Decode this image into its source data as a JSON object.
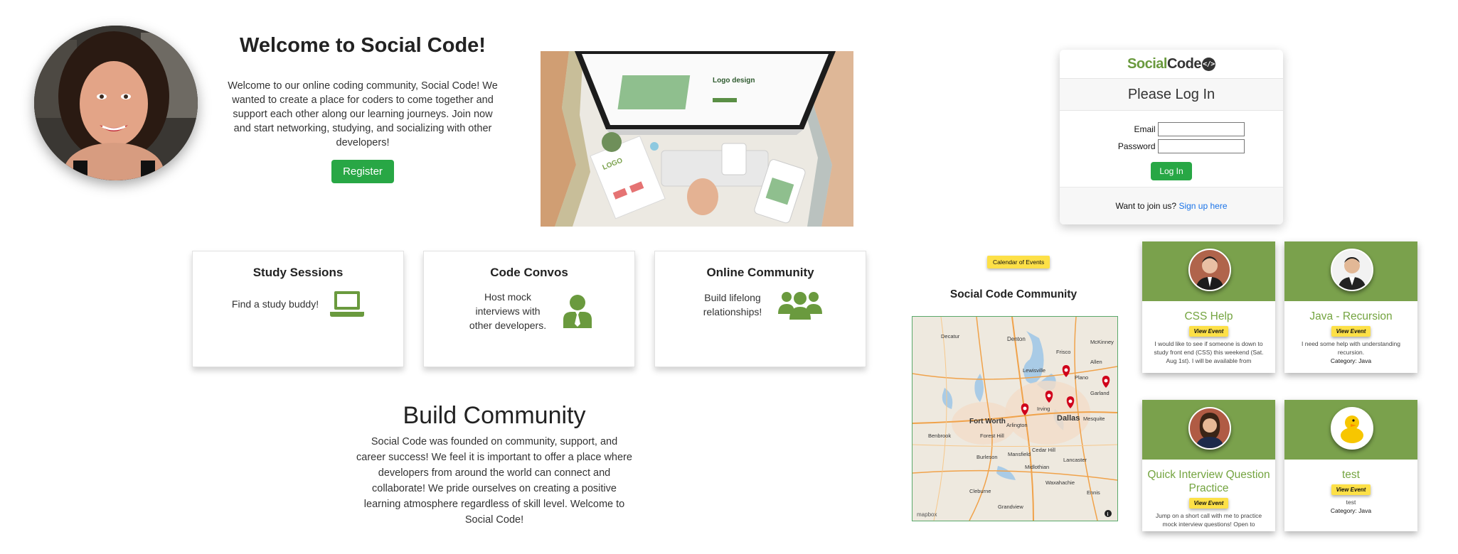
{
  "welcome": {
    "title": "Welcome to Social Code!",
    "body": "Welcome to our online coding community, Social Code! We wanted to create a place for coders to come together and support each other along our learning journeys. Join now and start networking, studying, and socializing with other developers!",
    "register_label": "Register"
  },
  "hero": {
    "screen_heading": "Logo design",
    "card_label": "LOGO"
  },
  "login": {
    "logo_social": "Social",
    "logo_code": "Code",
    "logo_badge": "</>",
    "heading": "Please Log In",
    "email_label": "Email",
    "password_label": "Password",
    "button_label": "Log In",
    "join_text": "Want to join us?",
    "signup_link": "Sign up here"
  },
  "features": [
    {
      "title": "Study Sessions",
      "text": "Find a study buddy!",
      "icon": "laptop-icon"
    },
    {
      "title": "Code Convos",
      "text": "Host mock interviews with other developers.",
      "icon": "person-tie-icon"
    },
    {
      "title": "Online Community",
      "text": "Build lifelong relationships!",
      "icon": "users-icon"
    }
  ],
  "build": {
    "title": "Build Community",
    "body": "Social Code was founded on community, support, and career success! We feel it is important to offer a place where developers from around the world can connect and collaborate! We pride ourselves on creating a positive learning atmosphere regardless of skill level. Welcome to Social Code!"
  },
  "calendar": {
    "badge": "Calendar of Events"
  },
  "community": {
    "title": "Social Code Community"
  },
  "map": {
    "cities": [
      "Decatur",
      "Denton",
      "McKinney",
      "Frisco",
      "Allen",
      "Lewisville",
      "Plano",
      "Garland",
      "Irving",
      "Dallas",
      "Mesquite",
      "Fort Worth",
      "Arlington",
      "Benbrook",
      "Forest Hill",
      "Cedar Hill",
      "Burleson",
      "Mansfield",
      "Midlothian",
      "Lancaster",
      "Waxahachie",
      "Cleburne",
      "Ennis",
      "Grandview"
    ],
    "attribution": "mapbox",
    "info_icon": "i"
  },
  "events": [
    {
      "title": "CSS Help",
      "view_label": "View Event",
      "description": "I would like to see if someone is down to study front end (CSS) this weekend (Sat. Aug 1st). I will be available from",
      "category": ""
    },
    {
      "title": "Java - Recursion",
      "view_label": "View Event",
      "description": "I need some help with understanding recursion.",
      "category": "Category: Java"
    },
    {
      "title": "Quick Interview Question Practice",
      "view_label": "View Event",
      "description": "Jump on a short call with me to practice mock interview questions! Open to",
      "category": ""
    },
    {
      "title": "test",
      "view_label": "View Event",
      "description": "test",
      "category": "Category: Java"
    }
  ],
  "colors": {
    "brand_green": "#28a745",
    "banner_green": "#7aa14c",
    "title_green": "#74a440",
    "badge_yellow": "#fde047",
    "link_blue": "#1a73e8",
    "pin_red": "#d0021b"
  }
}
